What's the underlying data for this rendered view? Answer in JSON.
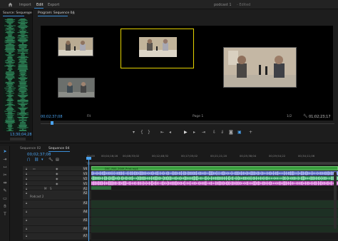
{
  "topbar": {
    "menu": [
      "Import",
      "Edit",
      "Export"
    ],
    "project_name": "podcast 1",
    "project_status": "- Edited"
  },
  "source": {
    "tab_label": "Source: Sequence",
    "timecode": "13;30;04;28"
  },
  "program": {
    "tab_label": "Program: Sequence 04",
    "timecode": "00;02;37;08",
    "fit_value": "Fit",
    "page_indicator": "Page 1",
    "quality_value": "1/2",
    "duration": "01;02;23;17"
  },
  "timeline": {
    "tabs": [
      "Sequence 02",
      "Sequence 04"
    ],
    "timecode": "00;02;37;08",
    "ruler_labels": [
      "00;00",
      "00;04;16;16",
      "00;08;33;02",
      "00;12;48;32",
      "00;17;05;02",
      "00;21;21;20",
      "00;25;38;04",
      "00;29;54;22",
      "00;34;11;06"
    ],
    "video_clip_label": "DSC_R00_2049_Print.mp4",
    "audio_clip_labels": [
      "",
      "",
      "",
      "",
      "",
      ""
    ],
    "tracks": [
      {
        "label": "V4",
        "type": "video"
      },
      {
        "label": "V3",
        "type": "video"
      },
      {
        "label": "V2",
        "type": "video"
      },
      {
        "label": "V1",
        "type": "video"
      },
      {
        "label": "A1",
        "type": "audio"
      },
      {
        "label": "A2",
        "type": "audio"
      },
      {
        "label": "A3",
        "type": "audio"
      },
      {
        "label": "A4",
        "type": "audio"
      },
      {
        "label": "A5",
        "type": "audio"
      },
      {
        "label": "A6",
        "type": "audio"
      },
      {
        "label": "A7",
        "type": "audio"
      }
    ],
    "sub_label": "Podcast 2"
  },
  "colors": {
    "accent": "#3b8dd6",
    "timecode": "#4aa3f0",
    "selection": "#e4d300",
    "video_clip": "#3fa143",
    "audio_blue": "#7a86d8",
    "audio_green": "#3fa37a",
    "audio_pink": "#d47ad4"
  }
}
